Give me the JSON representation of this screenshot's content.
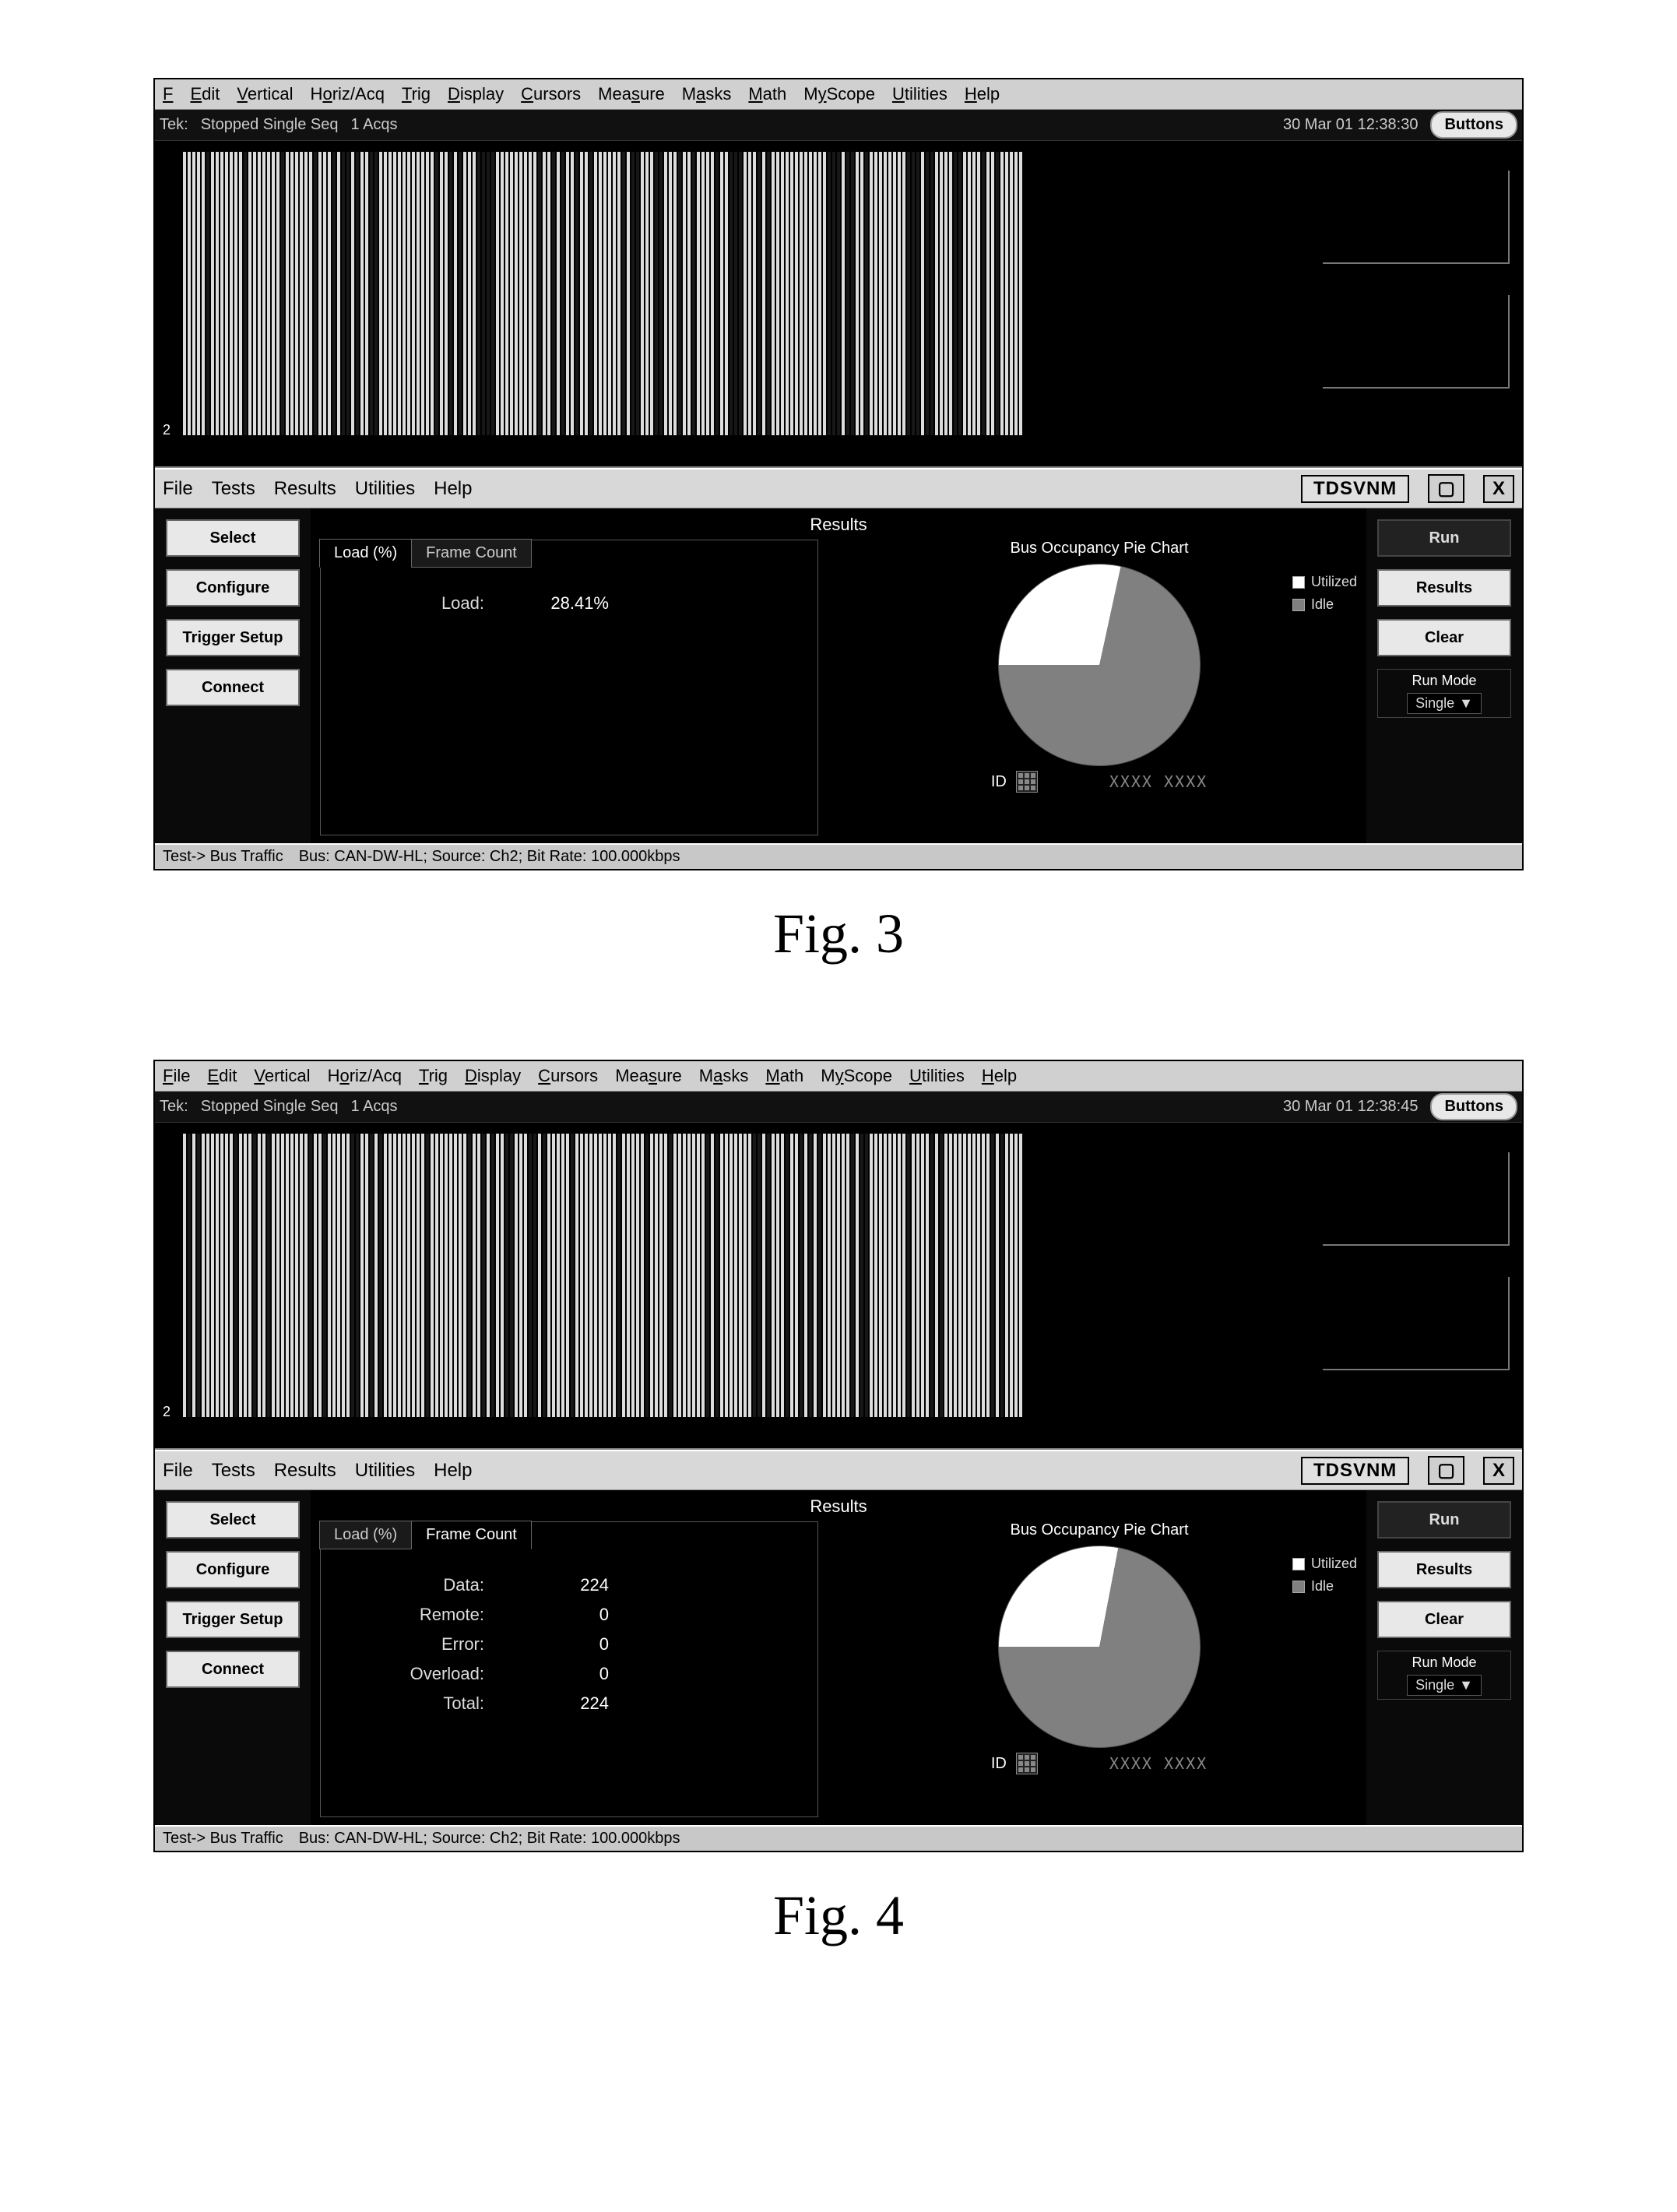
{
  "figures": [
    "Fig. 3",
    "Fig. 4"
  ],
  "menubar": [
    "File",
    "Edit",
    "Vertical",
    "Horiz/Acq",
    "Trig",
    "Display",
    "Cursors",
    "Measure",
    "Masks",
    "Math",
    "MyScope",
    "Utilities",
    "Help"
  ],
  "submenu": [
    "File",
    "Tests",
    "Results",
    "Utilities",
    "Help"
  ],
  "brand": "TDSVNM",
  "close_label": "X",
  "minimize_label": "▢",
  "buttons_badge": "Buttons",
  "scope": {
    "fig3": {
      "tek": "Tek:",
      "state": "Stopped  Single Seq",
      "acqs": "1 Acqs",
      "timestamp": "30 Mar 01 12:38:30",
      "ch": "2"
    },
    "fig4": {
      "tek": "Tek:",
      "state": "Stopped  Single Seq",
      "acqs": "1 Acqs",
      "timestamp": "30 Mar 01 12:38:45",
      "ch": "2"
    }
  },
  "left_buttons": [
    "Select",
    "Configure",
    "Trigger Setup",
    "Connect"
  ],
  "right_buttons": [
    "Run",
    "Results",
    "Clear"
  ],
  "runmode": {
    "title": "Run Mode",
    "value": "Single",
    "arrow": "▼"
  },
  "results_title": "Results",
  "tabs": {
    "load": "Load (%)",
    "frame": "Frame Count"
  },
  "fig3_tab_active": "load",
  "fig4_tab_active": "frame",
  "fig3_load": {
    "label": "Load:",
    "value": "28.41%"
  },
  "fig4_counts": [
    {
      "k": "Data:",
      "v": "224"
    },
    {
      "k": "Remote:",
      "v": "0"
    },
    {
      "k": "Error:",
      "v": "0"
    },
    {
      "k": "Overload:",
      "v": "0"
    },
    {
      "k": "Total:",
      "v": "224"
    }
  ],
  "chart_title": "Bus Occupancy Pie Chart",
  "legend": [
    {
      "label": "Utilized",
      "color": "#ffffff"
    },
    {
      "label": "Idle",
      "color": "#808080"
    }
  ],
  "id_label": "ID",
  "id_value": "XXXX XXXX",
  "statusbar": {
    "test": "Test-> Bus Traffic",
    "bus": "Bus: CAN-DW-HL; Source: Ch2; Bit Rate: 100.000kbps"
  },
  "chart_data": [
    {
      "figure": "Fig. 3",
      "type": "pie",
      "title": "Bus Occupancy Pie Chart",
      "series": [
        {
          "name": "Utilized",
          "value": 28.41,
          "color": "#ffffff"
        },
        {
          "name": "Idle",
          "value": 71.59,
          "color": "#808080"
        }
      ]
    },
    {
      "figure": "Fig. 4",
      "type": "pie",
      "title": "Bus Occupancy Pie Chart",
      "series": [
        {
          "name": "Utilized",
          "value": 28,
          "color": "#ffffff"
        },
        {
          "name": "Idle",
          "value": 72,
          "color": "#808080"
        }
      ]
    },
    {
      "figure": "Fig. 4",
      "type": "table",
      "title": "Frame Count",
      "categories": [
        "Data",
        "Remote",
        "Error",
        "Overload",
        "Total"
      ],
      "values": [
        224,
        0,
        0,
        0,
        224
      ]
    }
  ]
}
